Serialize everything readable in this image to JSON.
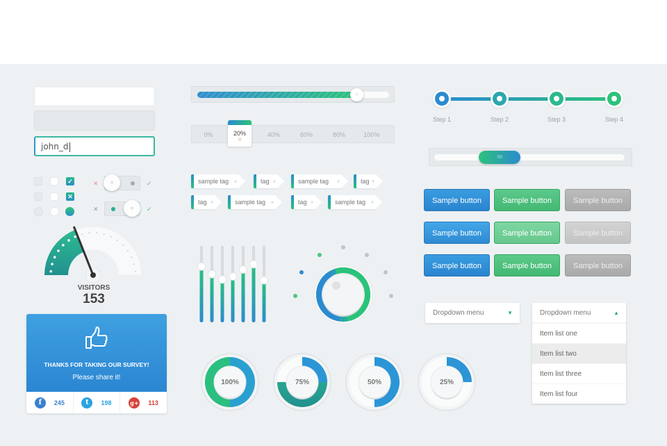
{
  "inputs": {
    "default_value": "",
    "disabled_value": "",
    "focused_value": "john_d"
  },
  "checkboxes": [
    {
      "kind": "checkbox",
      "state": "unchecked-gray"
    },
    {
      "kind": "checkbox",
      "state": "unchecked-white"
    },
    {
      "kind": "checkbox",
      "state": "checked",
      "glyph": "✓"
    },
    {
      "kind": "checkbox",
      "state": "unchecked-gray"
    },
    {
      "kind": "checkbox",
      "state": "unchecked-white"
    },
    {
      "kind": "checkbox",
      "state": "crossed",
      "glyph": "✕"
    },
    {
      "kind": "radio",
      "state": "unselected-gray"
    },
    {
      "kind": "radio",
      "state": "unselected-white"
    },
    {
      "kind": "radio",
      "state": "selected"
    }
  ],
  "toggles": [
    {
      "state": "off",
      "off_icon": "✕",
      "on_icon": "✓",
      "off_color": "#f08a8a",
      "on_color": "#999999"
    },
    {
      "state": "on",
      "off_icon": "✕",
      "on_icon": "✓",
      "off_color": "#999999",
      "on_color": "#3cc27a"
    }
  ],
  "gauge": {
    "label": "VISITORS",
    "value": "153",
    "fraction": 0.38,
    "accent": "#2aae93"
  },
  "survey": {
    "icon": "thumbs-up-icon",
    "title": "THANKS FOR TAKING OUR SURVEY!",
    "subtitle": "Please share it!",
    "shares": [
      {
        "network": "facebook",
        "glyph": "f",
        "count": "245",
        "color": "#3a7fd0"
      },
      {
        "network": "twitter",
        "glyph": "t",
        "count": "198",
        "color": "#2aa3e0"
      },
      {
        "network": "google-plus",
        "glyph": "g+",
        "count": "113",
        "color": "#d9403a"
      }
    ]
  },
  "progress": {
    "fraction": 0.83,
    "knob_glyph": "="
  },
  "percent_selector": {
    "options": [
      "0%",
      "20%",
      "40%",
      "60%",
      "80%",
      "100%"
    ],
    "selected": "20%",
    "grip": "III"
  },
  "tags": [
    {
      "label": "sample tag"
    },
    {
      "label": "tag"
    },
    {
      "label": "sample tag"
    },
    {
      "label": "tag"
    },
    {
      "label": "tag"
    },
    {
      "label": "sample tag"
    },
    {
      "label": "tag"
    },
    {
      "label": "sample tag"
    }
  ],
  "equalizer": {
    "levels": [
      0.73,
      0.63,
      0.56,
      0.6,
      0.69,
      0.76,
      0.55
    ]
  },
  "knob": {
    "fraction": 0.8,
    "dots": 9
  },
  "donuts": [
    {
      "label": "100%",
      "value": 100
    },
    {
      "label": "75%",
      "value": 75
    },
    {
      "label": "50%",
      "value": 50
    },
    {
      "label": "25%",
      "value": 25
    }
  ],
  "stepper": {
    "steps": [
      "Step 1",
      "Step 2",
      "Step 3",
      "Step 4"
    ],
    "colors": [
      "#2b8bd0",
      "#2aa7ad",
      "#2bb98f",
      "#2bc27a"
    ]
  },
  "scrollbar": {
    "position": 0.3,
    "grip": "IIII"
  },
  "buttons": {
    "rows": [
      [
        "Sample button",
        "Sample button",
        "Sample button"
      ],
      [
        "Sample button",
        "Sample button",
        "Sample button"
      ],
      [
        "Sample button",
        "Sample button",
        "Sample button"
      ]
    ]
  },
  "dropdowns": [
    {
      "label": "Dropdown menu",
      "state": "collapsed",
      "caret": "⌄"
    },
    {
      "label": "Dropdown menu",
      "state": "expanded",
      "caret": "⌃",
      "items": [
        "Item list one",
        "Item list two",
        "Item list three",
        "Item list four"
      ],
      "highlighted": "Item list two"
    }
  ],
  "colors": {
    "blue": "#2b8bd0",
    "green": "#2bc27a",
    "teal": "#2aae93",
    "background": "#eef1f3"
  }
}
